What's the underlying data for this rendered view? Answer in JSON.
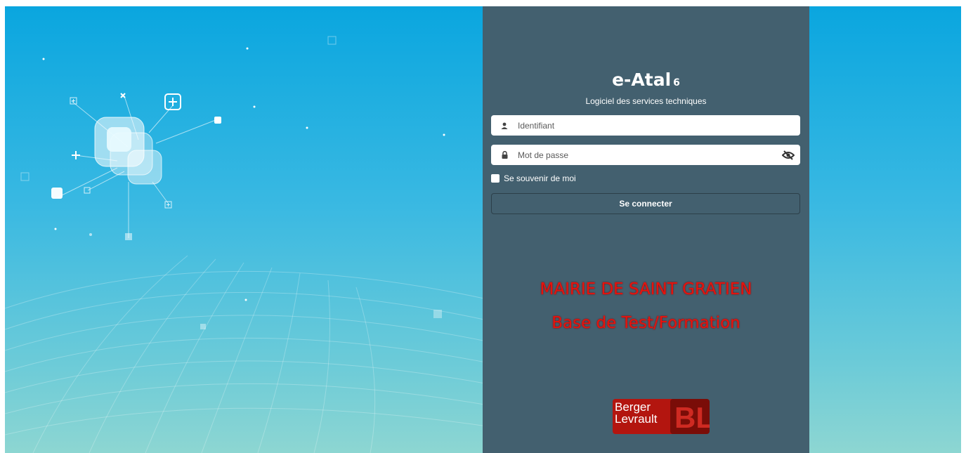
{
  "app": {
    "name": "e-Atal",
    "version": "6",
    "subtitle": "Logiciel des services techniques"
  },
  "login": {
    "username_placeholder": "Identifiant",
    "password_placeholder": "Mot de passe",
    "remember_label": "Se souvenir de moi",
    "submit_label": "Se connecter"
  },
  "banner": {
    "line1": "MAIRIE DE SAINT GRATIEN",
    "line2": "Base de Test/Formation"
  },
  "logo": {
    "text_line1": "Berger",
    "text_line2": "Levrault",
    "monogram": "BL"
  },
  "colors": {
    "panel": "#43606f",
    "background_top": "#0aa6df",
    "background_bottom": "#8dd6d2",
    "banner_text": "#e8120c",
    "logo_red": "#b3150f"
  },
  "icons": {
    "username": "user-icon",
    "password": "lock-icon",
    "toggle_password": "eye-slash-icon"
  }
}
